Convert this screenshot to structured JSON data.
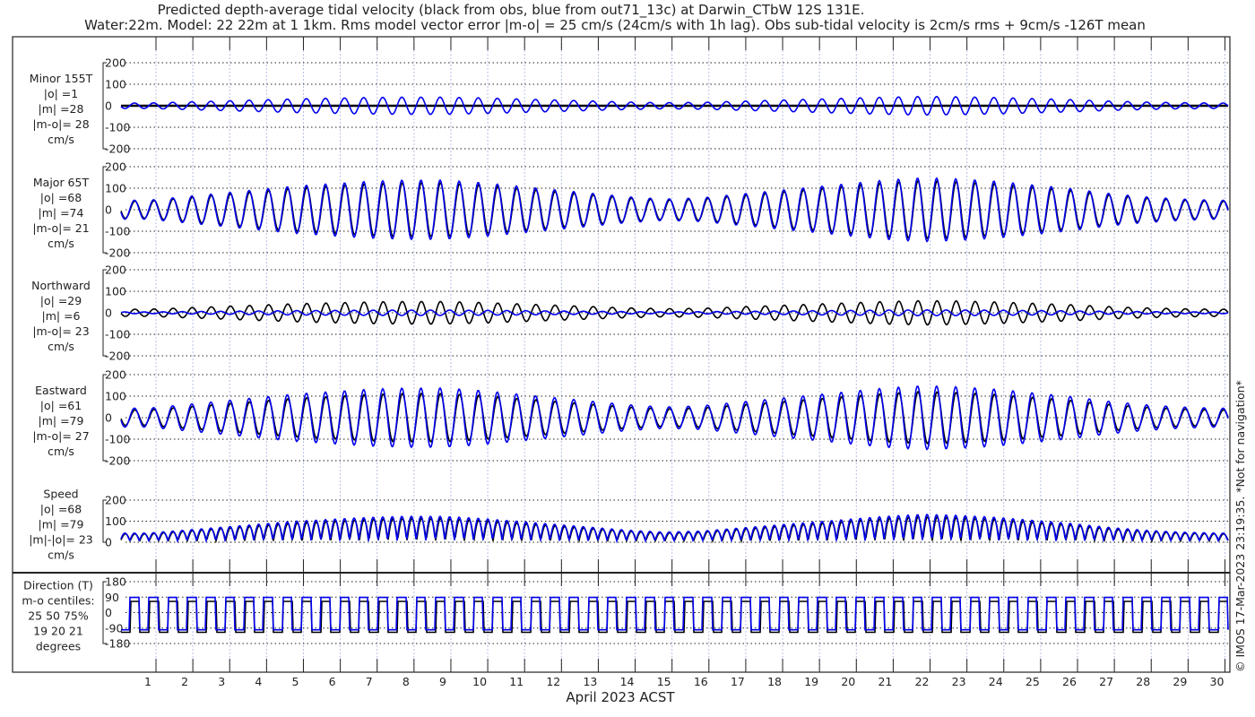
{
  "chart_data": {
    "type": "line",
    "title_line1": "Predicted depth-average tidal velocity (black from obs, blue from out71_13c) at Darwin_CTbW 12S 131E.",
    "title_line2": "Water:22m. Model: 22 22m at 1 1km. Rms model vector error |m-o| = 25 cm/s (24cm/s with 1h lag). Obs sub-tidal velocity is 2cm/s rms + 9cm/s -126T mean",
    "xlabel": "April 2023 ACST",
    "x_ticks": [
      "1",
      "2",
      "3",
      "4",
      "5",
      "6",
      "7",
      "8",
      "9",
      "10",
      "11",
      "12",
      "13",
      "14",
      "15",
      "16",
      "17",
      "18",
      "19",
      "20",
      "21",
      "22",
      "23",
      "24",
      "25",
      "26",
      "27",
      "28",
      "29",
      "30"
    ],
    "xlim": [
      0.27,
      30.3
    ],
    "copyright": "© IMOS 17-Mar-2023 23:19:35. *Not for navigation*",
    "series_colors": {
      "obs": "#000000",
      "model": "#0000ee"
    },
    "tidal_cycles_per_day": 1.93,
    "daily_major_amplitude_obs": [
      40,
      55,
      70,
      85,
      100,
      110,
      120,
      125,
      125,
      115,
      100,
      85,
      70,
      55,
      45,
      50,
      65,
      80,
      95,
      110,
      125,
      135,
      130,
      120,
      105,
      90,
      70,
      55,
      45,
      40
    ],
    "panels": [
      {
        "id": "minor",
        "label": [
          "Minor 155T",
          "|o| =1",
          "|m| =28",
          "|m-o|= 28",
          "cm/s"
        ],
        "ylim": [
          -200,
          200
        ],
        "yticks": [
          "200",
          "100",
          "0",
          "-100",
          "-200"
        ],
        "obs_scale": 0.0,
        "model_scale": 0.32
      },
      {
        "id": "major",
        "label": [
          "Major 65T",
          "|o| =68",
          "|m| =74",
          "|m-o|= 21",
          "cm/s"
        ],
        "ylim": [
          -200,
          200
        ],
        "yticks": [
          "200",
          "100",
          "0",
          "-100",
          "-200"
        ],
        "obs_scale": 1.0,
        "model_scale": 1.1
      },
      {
        "id": "north",
        "label": [
          "Northward",
          "|o| =29",
          "|m| =6",
          "|m-o|= 23",
          "cm/s"
        ],
        "ylim": [
          -200,
          200
        ],
        "yticks": [
          "200",
          "100",
          "0",
          "-100",
          "-200"
        ],
        "obs_scale": 0.42,
        "model_scale": 0.1
      },
      {
        "id": "east",
        "label": [
          "Eastward",
          "|o| =61",
          "|m| =79",
          "|m-o|= 27",
          "cm/s"
        ],
        "ylim": [
          -200,
          200
        ],
        "yticks": [
          "200",
          "100",
          "0",
          "-100",
          "-200"
        ],
        "obs_scale": 0.9,
        "model_scale": 1.1
      },
      {
        "id": "speed",
        "label": [
          "Speed",
          "|o| =68",
          "|m| =79",
          "|m|-|o|= 23",
          "cm/s"
        ],
        "ylim": [
          0,
          200
        ],
        "yticks": [
          "200",
          "100",
          "0"
        ],
        "obs_scale": 1.0,
        "model_scale": 1.1
      },
      {
        "id": "direction",
        "label": [
          "Direction (T)",
          "m-o centiles:",
          "25  50  75%",
          "19  20  21",
          "degrees"
        ],
        "ylim": [
          -180,
          180
        ],
        "yticks": [
          "180",
          "90",
          "0",
          "-90",
          "-180"
        ],
        "obs_levels": [
          65,
          -115
        ],
        "model_levels": [
          88,
          -100
        ]
      }
    ]
  }
}
